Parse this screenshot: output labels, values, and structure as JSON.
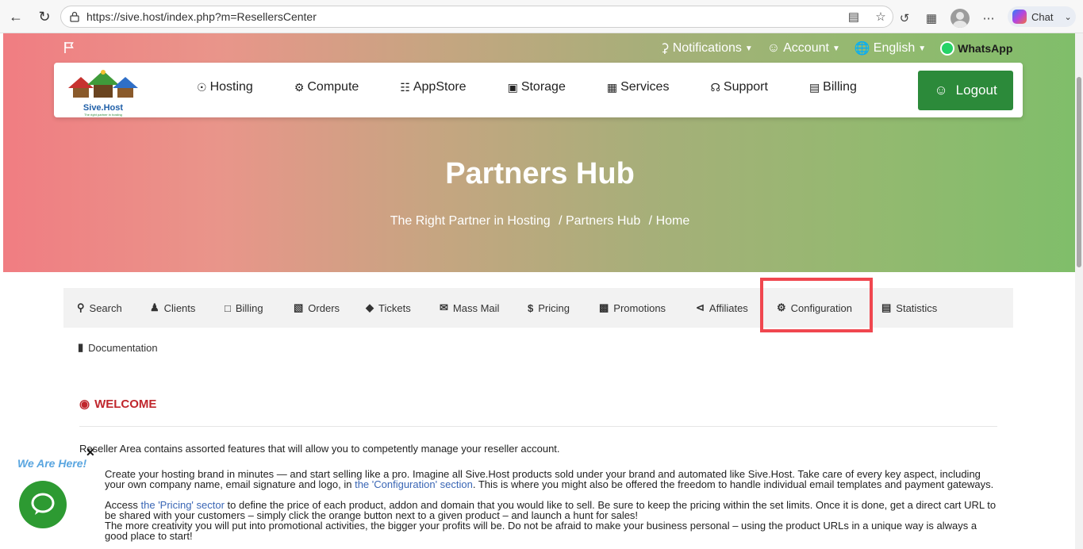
{
  "browser": {
    "url": "https://sive.host/index.php?m=ResellersCenter",
    "chat_label": "Chat"
  },
  "topbar": {
    "notifications": "Notifications",
    "account": "Account",
    "language": "English",
    "whatsapp": "WhatsApp"
  },
  "nav": {
    "logo_text": "Sive.Host",
    "logo_tagline": "The right partner in hosting",
    "items": [
      {
        "label": "Hosting",
        "icon": "globe-icon"
      },
      {
        "label": "Compute",
        "icon": "gear-icon"
      },
      {
        "label": "AppStore",
        "icon": "database-icon"
      },
      {
        "label": "Storage",
        "icon": "cube-icon"
      },
      {
        "label": "Services",
        "icon": "gift-icon"
      },
      {
        "label": "Support",
        "icon": "headset-icon"
      },
      {
        "label": "Billing",
        "icon": "receipt-icon"
      }
    ],
    "logout": "Logout"
  },
  "hero": {
    "title": "Partners Hub",
    "breadcrumb": [
      "The Right Partner in Hosting",
      "/ Partners Hub",
      "/ Home"
    ]
  },
  "tabs": [
    {
      "label": "Search",
      "icon": "search-icon"
    },
    {
      "label": "Clients",
      "icon": "users-icon"
    },
    {
      "label": "Billing",
      "icon": "file-icon"
    },
    {
      "label": "Orders",
      "icon": "cart-icon"
    },
    {
      "label": "Tickets",
      "icon": "ticket-icon"
    },
    {
      "label": "Mass Mail",
      "icon": "envelope-icon"
    },
    {
      "label": "Pricing",
      "icon": "dollar-icon"
    },
    {
      "label": "Promotions",
      "icon": "money-icon"
    },
    {
      "label": "Affiliates",
      "icon": "share-icon"
    },
    {
      "label": "Configuration",
      "icon": "cogs-icon"
    },
    {
      "label": "Statistics",
      "icon": "bar-chart-icon"
    }
  ],
  "documentation_tab": "Documentation",
  "content": {
    "welcome": "WELCOME",
    "intro": "Reseller Area contains assorted features that will allow you to competently manage your reseller account.",
    "p1_a": "Create your hosting brand in minutes — and start selling like a pro. Imagine all Sive.Host products sold under your brand and automated like Sive.Host. Take care of every key aspect, including your own company name, email signature and logo, in ",
    "p1_link": "the 'Configuration' section",
    "p1_b": ". This is where you might also be offered the freedom to handle individual email templates and payment gateways.",
    "p2_a": "Access ",
    "p2_link": "the 'Pricing' sector",
    "p2_b": " to define the price of each product, addon and domain that you would like to sell. Be sure to keep the pricing within the set limits. Once it is done, get a direct cart URL to be shared with your customers – simply click the orange button next to a given product – and launch a hunt for sales!",
    "p3": "The more creativity you will put into promotional activities, the bigger your profits will be. Do not be afraid to make your business personal – using the product URLs in a unique way is always a good place to start!"
  },
  "chat_widget": {
    "label": "We Are Here!"
  }
}
